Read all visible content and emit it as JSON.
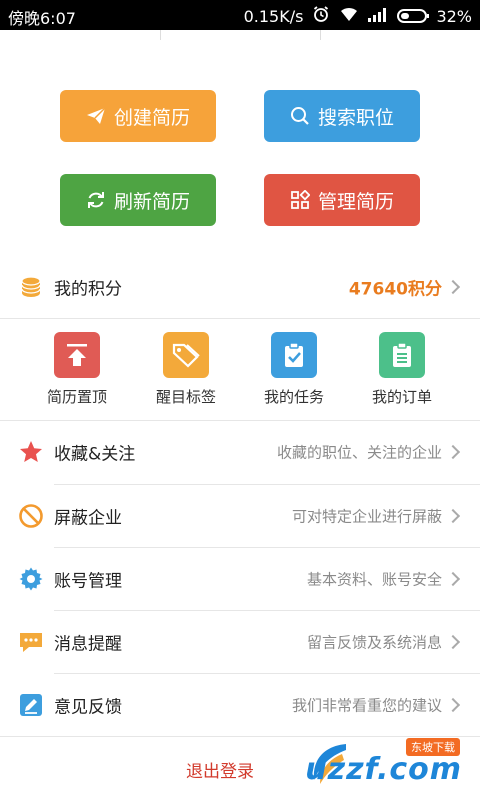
{
  "status_bar": {
    "time": "傍晚6:07",
    "speed": "0.15K/s",
    "battery": "32%"
  },
  "actions": {
    "create": "创建简历",
    "search": "搜索职位",
    "refresh": "刷新简历",
    "manage": "管理简历"
  },
  "points": {
    "label": "我的积分",
    "value": "47640积分"
  },
  "grid": [
    {
      "label": "简历置顶",
      "color": "#e05b55"
    },
    {
      "label": "醒目标签",
      "color": "#f3a93a"
    },
    {
      "label": "我的任务",
      "color": "#3d9ede"
    },
    {
      "label": "我的订单",
      "color": "#4cc08a"
    }
  ],
  "menu": [
    {
      "label": "收藏&关注",
      "desc": "收藏的职位、关注的企业"
    },
    {
      "label": "屏蔽企业",
      "desc": "可对特定企业进行屏蔽"
    },
    {
      "label": "账号管理",
      "desc": "基本资料、账号安全"
    },
    {
      "label": "消息提醒",
      "desc": "留言反馈及系统消息"
    },
    {
      "label": "意见反馈",
      "desc": "我们非常看重您的建议"
    }
  ],
  "logout": "退出登录",
  "watermark": {
    "badge": "东坡下载",
    "text": "uzzf.com"
  },
  "colors": {
    "orange": "#f6a33a",
    "blue": "#3d9ede",
    "green": "#4ea443",
    "red": "#e05543",
    "points": "#e97c1f",
    "logout": "#d23a2c"
  }
}
